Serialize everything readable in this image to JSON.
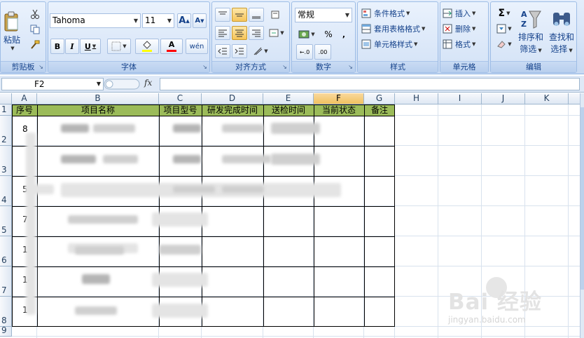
{
  "ribbon": {
    "clipboard": {
      "label": "剪贴板",
      "paste_label": "粘贴"
    },
    "font": {
      "label": "字体",
      "font_name": "Tahoma",
      "font_size": "11",
      "grow_label": "A",
      "shrink_label": "A",
      "bold": "B",
      "italic": "I",
      "underline": "U",
      "fill_color": "#ffff00",
      "font_color": "#ff0000",
      "phonetic_label": "wén"
    },
    "alignment": {
      "label": "对齐方式"
    },
    "number": {
      "label": "数字",
      "format": "常规",
      "percent": "%",
      "comma": ",",
      "inc_decimal": "←.0",
      "dec_decimal": ".00"
    },
    "styles": {
      "label": "样式",
      "items": [
        "条件格式",
        "套用表格格式",
        "单元格样式"
      ]
    },
    "cells": {
      "label": "单元格",
      "items": [
        "插入",
        "删除",
        "格式"
      ]
    },
    "editing": {
      "label": "编辑",
      "sort_label": "排序和",
      "sort_label2": "筛选",
      "find_label": "查找和",
      "find_label2": "选择",
      "sigma": "Σ"
    }
  },
  "formula_bar": {
    "name_box": "F2",
    "fx": "fx",
    "value": ""
  },
  "grid": {
    "columns": [
      "A",
      "B",
      "C",
      "D",
      "E",
      "F",
      "G",
      "H",
      "I",
      "J",
      "K"
    ],
    "selected_column": "F",
    "rows": [
      "1",
      "2",
      "3",
      "4",
      "5",
      "6",
      "7",
      "8",
      "9"
    ]
  },
  "table": {
    "headers": [
      "序号",
      "项目名称",
      "项目型号",
      "研发完成时间",
      "送检时间",
      "当前状态",
      "备注"
    ],
    "header_color": "#9bbb59",
    "ids": [
      "8",
      "",
      "5",
      "7",
      "13",
      "14",
      "1"
    ]
  },
  "watermark": {
    "brand": "Bai 经验",
    "url": "jingyan.baidu.com"
  }
}
